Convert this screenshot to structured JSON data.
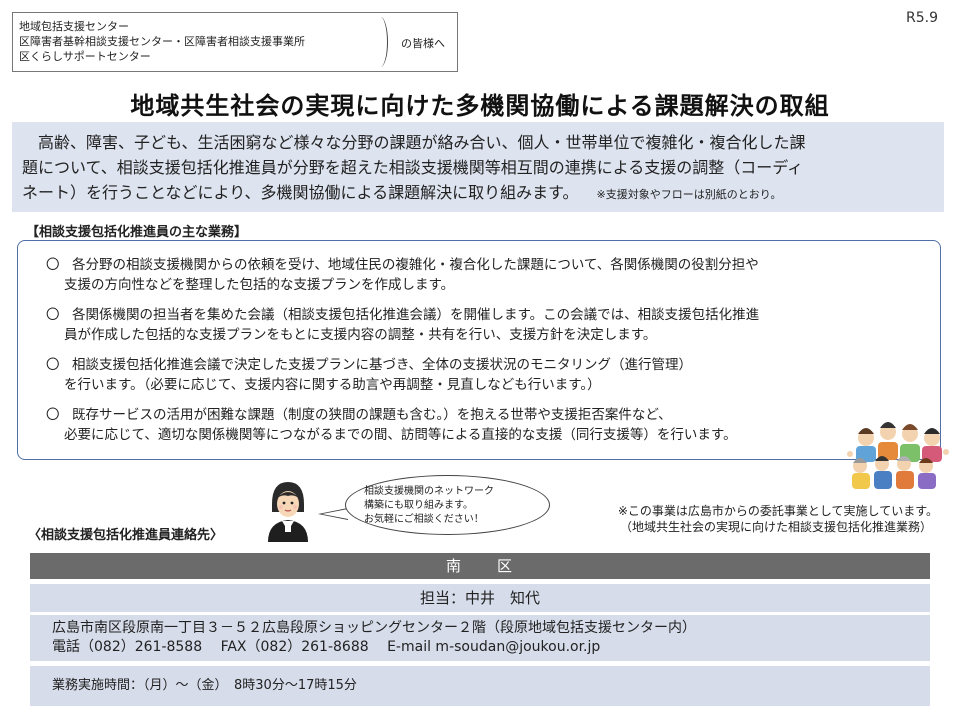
{
  "addressee": {
    "lines": [
      "地域包括支援センター",
      "区障害者基幹相談支援センター・区障害者相談支援事業所",
      "区くらしサポートセンター"
    ],
    "honorific": "の皆様へ"
  },
  "date": "R5.9",
  "title": "地域共生社会の実現に向けた多機関協働による課題解決の取組",
  "intro": {
    "line1": "高齢、障害、子ども、生活困窮など様々な分野の課題が絡み合い、個人・世帯単位で複雑化・複合化した課",
    "line2": "題について、相談支援包括化推進員が分野を超えた相談支援機関等相互間の連携による支援の調整（コーディ",
    "line3": "ネート）を行うことなどにより、多機関協働による課題解決に取り組みます。",
    "note": "※支援対象やフローは別紙のとおり。"
  },
  "duties": {
    "heading": "【相談支援包括化推進員の主な業務】",
    "bullet": "〇",
    "items": [
      {
        "line1": "各分野の相談支援機関からの依頼を受け、地域住民の複雑化・複合化した課題について、各関係機関の役割分担や",
        "line2": "支援の方向性などを整理した包括的な支援プランを作成します。"
      },
      {
        "line1": "各関係機関の担当者を集めた会議（相談支援包括化推進会議）を開催します。この会議では、相談支援包括化推進",
        "line2": "員が作成した包括的な支援プランをもとに支援内容の調整・共有を行い、支援方針を決定します。"
      },
      {
        "line1": "相談支援包括化推進会議で決定した支援プランに基づき、全体の支援状況のモニタリング（進行管理）",
        "line2": "を行います。（必要に応じて、支援内容に関する助言や再調整・見直しなども行います。）"
      },
      {
        "line1": "既存サービスの活用が困難な課題（制度の狭間の課題も含む。）を抱える世帯や支援拒否案件など、",
        "line2": "必要に応じて、適切な関係機関等につながるまでの間、訪問等による直接的な支援（同行支援等）を行います。"
      }
    ]
  },
  "bubble": {
    "lines": [
      "相談支援機関のネットワーク",
      "構築にも取り組みます。",
      "お気軽にご相談ください！"
    ]
  },
  "contact_heading": "〈相談支援包括化推進員連絡先〉",
  "commission": {
    "line1": "※この事業は広島市からの委託事業として実施しています。",
    "line2": "（地域共生社会の実現に向けた相談支援包括化推進業務）"
  },
  "contact": {
    "ward": "南　　区",
    "person": "担当：中井　知代",
    "address": "広島市南区段原南一丁目３－５２広島段原ショッピングセンター２階（段原地域包括支援センター内）",
    "phone_line": "電話（082）261-8588　 FAX（082）261-8688　 E-mail  m-soudan@joukou.or.jp",
    "hours": "業務実施時間：（月）～（金）　8時30分～17時15分"
  },
  "colors": {
    "intro_bg": "#dde3ef",
    "table_header_bg": "#6b6b6b",
    "table_row_bg": "#d6dcea",
    "duties_border": "#4f6fa6"
  },
  "icons": {
    "woman": "woman-staff-illustration",
    "crowd": "people-group-illustration"
  }
}
